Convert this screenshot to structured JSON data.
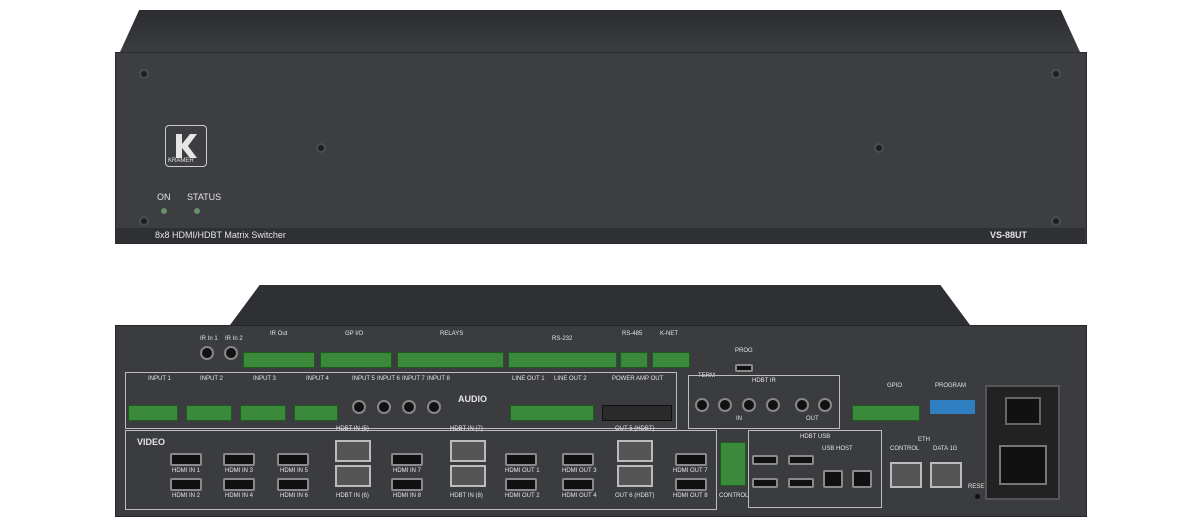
{
  "front": {
    "led_on": "ON",
    "led_status": "STATUS",
    "model_description": "8x8 HDMI/HDBT Matrix Switcher",
    "model_number": "VS-88UT",
    "brand": "KRAMER"
  },
  "rear": {
    "ir_in_1": "IR In 1",
    "ir_in_2": "IR In 2",
    "ir_out": "IR Out",
    "gpio": "GP I/O",
    "relays": "RELAYS",
    "rs232": "RS-232",
    "rs485": "RS-485",
    "knet": "K-NET",
    "term": "TERM",
    "prog": "PROG",
    "input1": "INPUT 1",
    "input2": "INPUT 2",
    "input3": "INPUT 3",
    "input4": "INPUT 4",
    "input5": "INPUT 5",
    "input6": "INPUT 6",
    "input7": "INPUT 7",
    "input8": "INPUT 8",
    "audio": "AUDIO",
    "line_out_1": "LINE OUT 1",
    "line_out_2": "LINE OUT 2",
    "power_amp_out": "POWER AMP OUT",
    "hdbt_ir": "HDBT IR",
    "ir_in": "IN",
    "ir_outlbl": "OUT",
    "gpio2": "GPIO",
    "program": "PROGRAM",
    "video": "VIDEO",
    "hdmi_in_1": "HDMI IN 1",
    "hdmi_in_2": "HDMI IN 2",
    "hdmi_in_3": "HDMI IN 3",
    "hdmi_in_4": "HDMI IN 4",
    "hdmi_in_5": "HDMI IN 5",
    "hdmi_in_6": "HDMI IN 6",
    "hdbt_in_5": "HDBT IN (5)",
    "hdbt_in_6": "HDBT IN (6)",
    "hdmi_in_7": "HDMI IN 7",
    "hdmi_in_8": "HDMI IN 8",
    "hdbt_in_7": "HDBT IN (7)",
    "hdbt_in_8": "HDBT IN (8)",
    "hdmi_out_1": "HDMI OUT 1",
    "hdmi_out_2": "HDMI OUT 2",
    "hdmi_out_3": "HDMI OUT 3",
    "hdmi_out_4": "HDMI OUT 4",
    "out_5_hdbt": "OUT 5 (HDBT)",
    "out_6_hdbt": "OUT 6 (HDBT)",
    "hdmi_out_7": "HDMI OUT 7",
    "hdmi_out_8": "HDMI OUT 8",
    "rs232_control": "CONTROL",
    "hdbt_usb": "HDBT USB",
    "usb_host": "USB HOST",
    "eth": "ETH",
    "control": "CONTROL",
    "data_1g": "DATA 1G",
    "reset": "RESET"
  }
}
